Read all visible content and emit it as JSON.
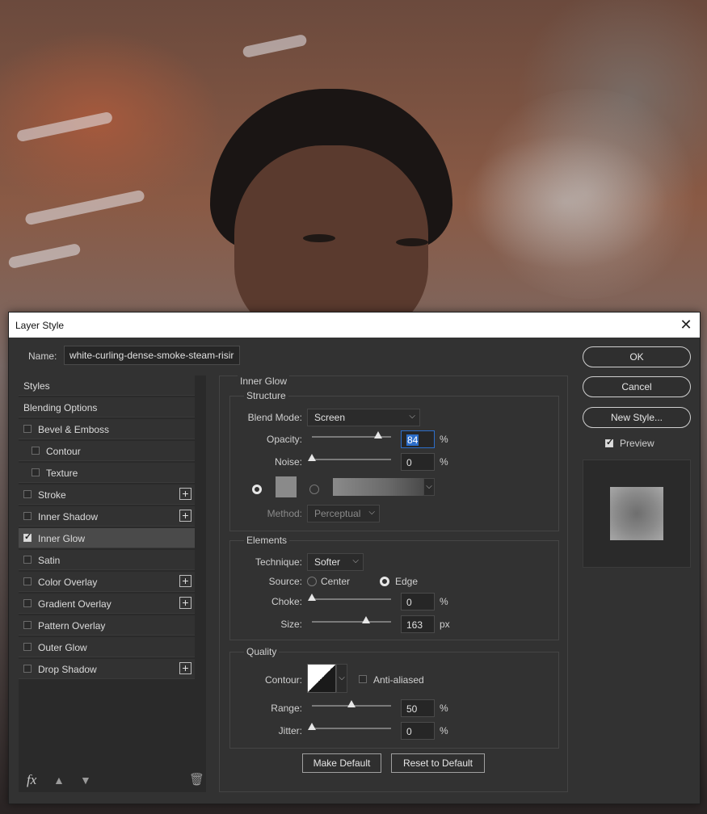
{
  "dialog": {
    "title": "Layer Style",
    "name_label": "Name:",
    "name_value": "white-curling-dense-smoke-steam-risir"
  },
  "sidebar": {
    "items": [
      {
        "label": "Styles",
        "checkbox": false,
        "checked": false,
        "plus": false,
        "indent": false
      },
      {
        "label": "Blending Options",
        "checkbox": false,
        "checked": false,
        "plus": false,
        "indent": false
      },
      {
        "label": "Bevel & Emboss",
        "checkbox": true,
        "checked": false,
        "plus": false,
        "indent": false
      },
      {
        "label": "Contour",
        "checkbox": true,
        "checked": false,
        "plus": false,
        "indent": true
      },
      {
        "label": "Texture",
        "checkbox": true,
        "checked": false,
        "plus": false,
        "indent": true
      },
      {
        "label": "Stroke",
        "checkbox": true,
        "checked": false,
        "plus": true,
        "indent": false
      },
      {
        "label": "Inner Shadow",
        "checkbox": true,
        "checked": false,
        "plus": true,
        "indent": false
      },
      {
        "label": "Inner Glow",
        "checkbox": true,
        "checked": true,
        "plus": false,
        "indent": false,
        "active": true
      },
      {
        "label": "Satin",
        "checkbox": true,
        "checked": false,
        "plus": false,
        "indent": false
      },
      {
        "label": "Color Overlay",
        "checkbox": true,
        "checked": false,
        "plus": true,
        "indent": false
      },
      {
        "label": "Gradient Overlay",
        "checkbox": true,
        "checked": false,
        "plus": true,
        "indent": false
      },
      {
        "label": "Pattern Overlay",
        "checkbox": true,
        "checked": false,
        "plus": false,
        "indent": false
      },
      {
        "label": "Outer Glow",
        "checkbox": true,
        "checked": false,
        "plus": false,
        "indent": false
      },
      {
        "label": "Drop Shadow",
        "checkbox": true,
        "checked": false,
        "plus": true,
        "indent": false
      }
    ],
    "fx_label": "fx"
  },
  "panel": {
    "section_title": "Inner Glow",
    "structure": {
      "title": "Structure",
      "blend_mode_label": "Blend Mode:",
      "blend_mode_value": "Screen",
      "opacity_label": "Opacity:",
      "opacity_value": "84",
      "opacity_unit": "%",
      "opacity_fraction": 0.84,
      "noise_label": "Noise:",
      "noise_value": "0",
      "noise_unit": "%",
      "noise_fraction": 0,
      "method_label": "Method:",
      "method_value": "Perceptual"
    },
    "elements": {
      "title": "Elements",
      "technique_label": "Technique:",
      "technique_value": "Softer",
      "source_label": "Source:",
      "source_center": "Center",
      "source_edge": "Edge",
      "choke_label": "Choke:",
      "choke_value": "0",
      "choke_unit": "%",
      "choke_fraction": 0,
      "size_label": "Size:",
      "size_value": "163",
      "size_unit": "px",
      "size_fraction": 0.68
    },
    "quality": {
      "title": "Quality",
      "contour_label": "Contour:",
      "anti_aliased_label": "Anti-aliased",
      "range_label": "Range:",
      "range_value": "50",
      "range_unit": "%",
      "range_fraction": 0.5,
      "jitter_label": "Jitter:",
      "jitter_value": "0",
      "jitter_unit": "%",
      "jitter_fraction": 0
    },
    "make_default_label": "Make Default",
    "reset_default_label": "Reset to Default"
  },
  "actions": {
    "ok_label": "OK",
    "cancel_label": "Cancel",
    "new_style_label": "New Style...",
    "preview_label": "Preview"
  },
  "colors": {
    "glow_color": "#8a8a8a",
    "selection": "#2d6ec9"
  }
}
